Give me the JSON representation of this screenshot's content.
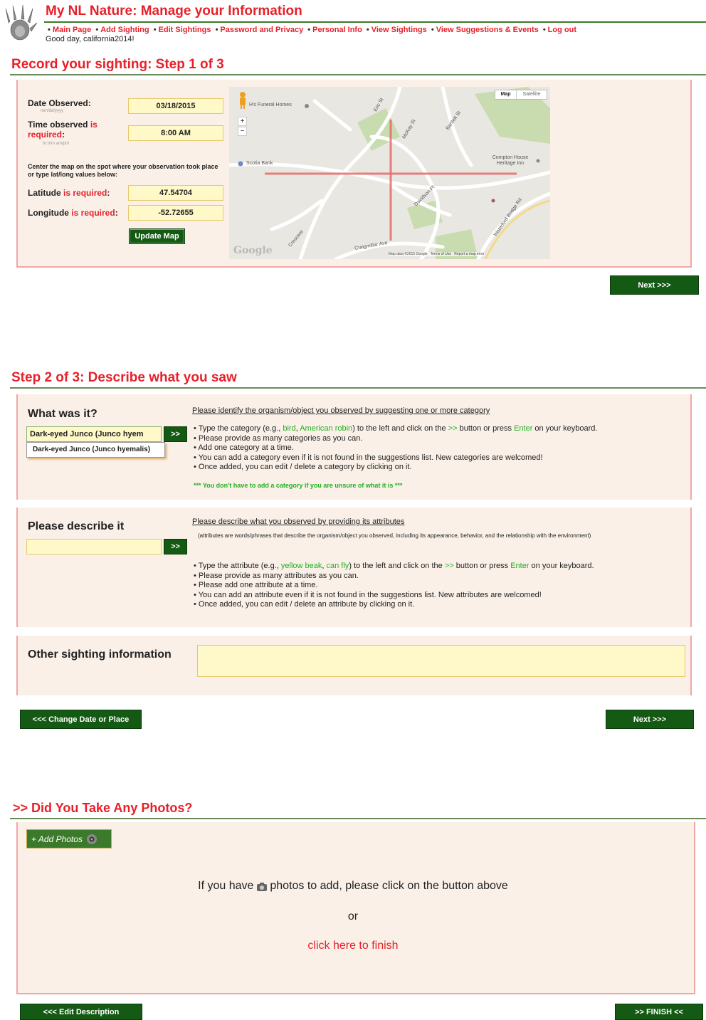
{
  "header": {
    "title": "My NL Nature: Manage your Information",
    "nav": [
      "Main Page",
      "Add Sighting",
      "Edit Sightings",
      "Password and Privacy",
      "Personal Info",
      "View Sightings",
      "View Suggestions & Events",
      "Log out"
    ],
    "greeting": "Good day, california2014!"
  },
  "step1": {
    "title": "Record your sighting: Step 1 of 3",
    "date_label": "Date Observed:",
    "date_hint": "mm/dd/yyyy",
    "date_value": "03/18/2015",
    "time_label": "Time observed",
    "time_label_red": "is required",
    "time_label_end": ":",
    "time_hint": "hr:mm am/pm",
    "time_value": "8:00 AM",
    "center_note": "Center the map on the spot where your observation took place or type lat/long values below:",
    "lat_label": "Latitude",
    "lat_req": "is required",
    "lat_colon": ":",
    "lat_value": "47.54704",
    "lon_label": "Longitude",
    "lon_req": "is required",
    "lon_colon": ":",
    "lon_value": "-52.72655",
    "update_btn": "Update Map",
    "next_btn": "Next >>>",
    "map": {
      "tab_map": "Map",
      "tab_satellite": "Satellite",
      "zoom_in": "+",
      "zoom_out": "−",
      "labels": [
        "H's Funeral Homes",
        "Scotia Bank",
        "Compton House Heritage Inn",
        "Eric St",
        "McKay St",
        "Bartlett St",
        "Davidson Pl",
        "Waterford Bridge Rd",
        "Craigmillar Ave",
        "Crescent"
      ],
      "google": "Google",
      "footer": "Map data ©2015 Google   Terms of Use   Report a map error"
    }
  },
  "step2": {
    "title": "Step 2 of 3: Describe what you saw",
    "what_label": "What was it?",
    "category_value": "Dark-eyed Junco (Junco hyem",
    "suggestion": "Dark-eyed Junco (Junco hyemalis)",
    "arrow_btn": ">>",
    "cat_head": "Please identify the organism/object you observed by suggesting one or more category",
    "cat_b1_a": "Type the category (e.g., ",
    "cat_b1_bird": "bird",
    "cat_b1_comma": ", ",
    "cat_b1_robin": "American robin",
    "cat_b1_b": ") to the left and click on the ",
    "cat_b1_arrows": ">>",
    "cat_b1_c": " button or press ",
    "cat_b1_enter": "Enter",
    "cat_b1_d": " on your keyboard.",
    "cat_bullets": [
      "Please provide as many categories as you can.",
      "Add one category at a time.",
      "You can add a category even if it is not found in the suggestions list. New categories are welcomed!",
      "Once added, you can edit / delete a category by clicking on it."
    ],
    "cat_note": "*** You don't have to add a category if you are unsure of what it is ***",
    "describe_label": "Please describe it",
    "attr_head": "Please describe what you observed by providing its attributes",
    "attr_sub": "(attributes are words/phrases that describe the organism/object you observed, including its appearance, behavior, and the relationship with the environment)",
    "attr_b1_a": "Type the attribute (e.g., ",
    "attr_b1_yb": "yellow beak",
    "attr_b1_comma": ", ",
    "attr_b1_cf": "can fly",
    "attr_b1_b": ") to the left and click on the ",
    "attr_b1_arrows": ">>",
    "attr_b1_c": " button or press ",
    "attr_b1_enter": "Enter",
    "attr_b1_d": " on your keyboard.",
    "attr_bullets": [
      "Please provide as many attributes as you can.",
      "Please add one attribute at a time.",
      "You can add an attribute even if it is not found in the suggestions list. New attributes are welcomed!",
      "Once added, you can edit / delete an attribute by clicking on it."
    ],
    "other_label": "Other sighting information",
    "back_btn": "<<< Change Date or Place",
    "next_btn": "Next >>>"
  },
  "step3": {
    "title": ">> Did You Take Any Photos?",
    "add_photos": "+ Add Photos",
    "line1_a": "If you have",
    "line1_b": "photos to add, please click on the button above",
    "or": "or",
    "finish_link": "click here to finish",
    "back_btn": "<<< Edit Description",
    "finish_btn": ">> FINISH <<"
  }
}
